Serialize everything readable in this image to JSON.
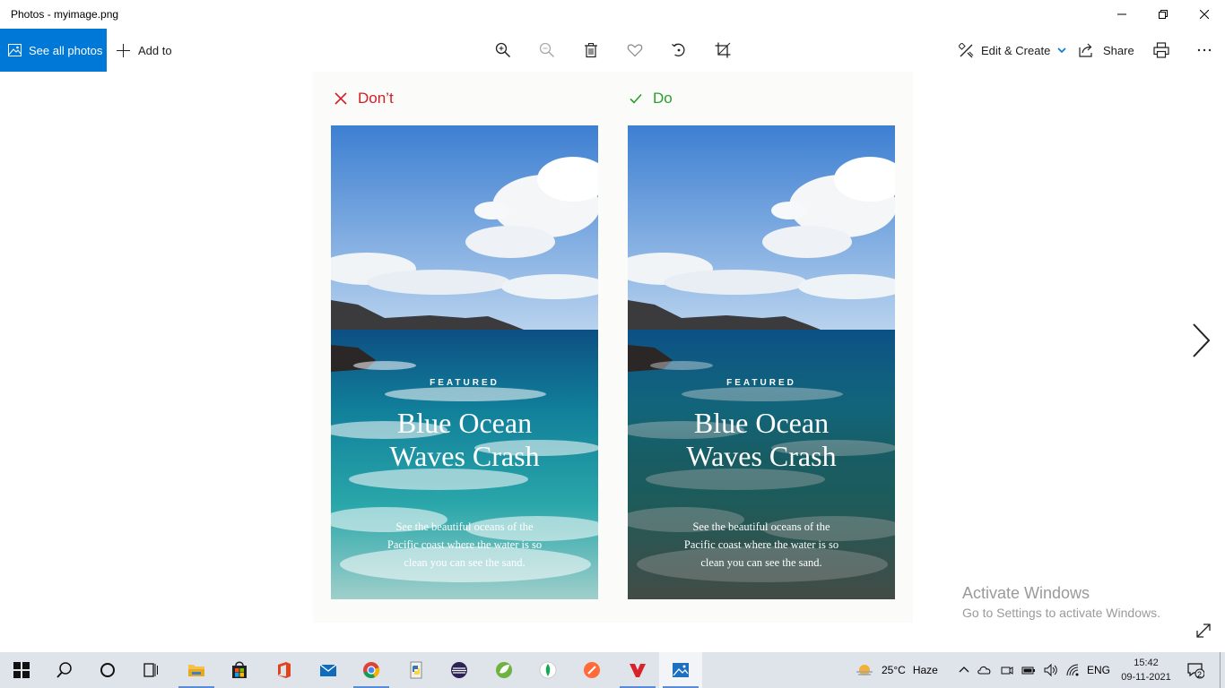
{
  "window": {
    "title": "Photos - myimage.png"
  },
  "toolbar": {
    "see_all_photos": "See all photos",
    "add_to": "Add to",
    "edit_create": "Edit & Create",
    "share": "Share",
    "icons": [
      "zoom-in-icon",
      "zoom-out-icon",
      "delete-icon",
      "favorite-icon",
      "rotate-icon",
      "crop-icon",
      "print-icon",
      "more-icon"
    ]
  },
  "image": {
    "dont_label": "Don’t",
    "do_label": "Do",
    "featured": "FEATURED",
    "headline_line1": "Blue Ocean",
    "headline_line2": "Waves Crash",
    "body_line1": "See the beautiful oceans of the",
    "body_line2": "Pacific coast where the water is so",
    "body_line3": "clean you can see the sand.",
    "colors": {
      "dont": "#d31d25",
      "do": "#2a9e2a"
    }
  },
  "watermark": {
    "line1": "Activate Windows",
    "line2": "Go to Settings to activate Windows."
  },
  "taskbar": {
    "weather_temp": "25°C",
    "weather_text": "Haze",
    "language": "ENG",
    "time": "15:42",
    "date": "09-11-2021",
    "notifications": "2"
  },
  "colors": {
    "accent": "#0078d7",
    "taskbar": "#dfe3ea"
  }
}
